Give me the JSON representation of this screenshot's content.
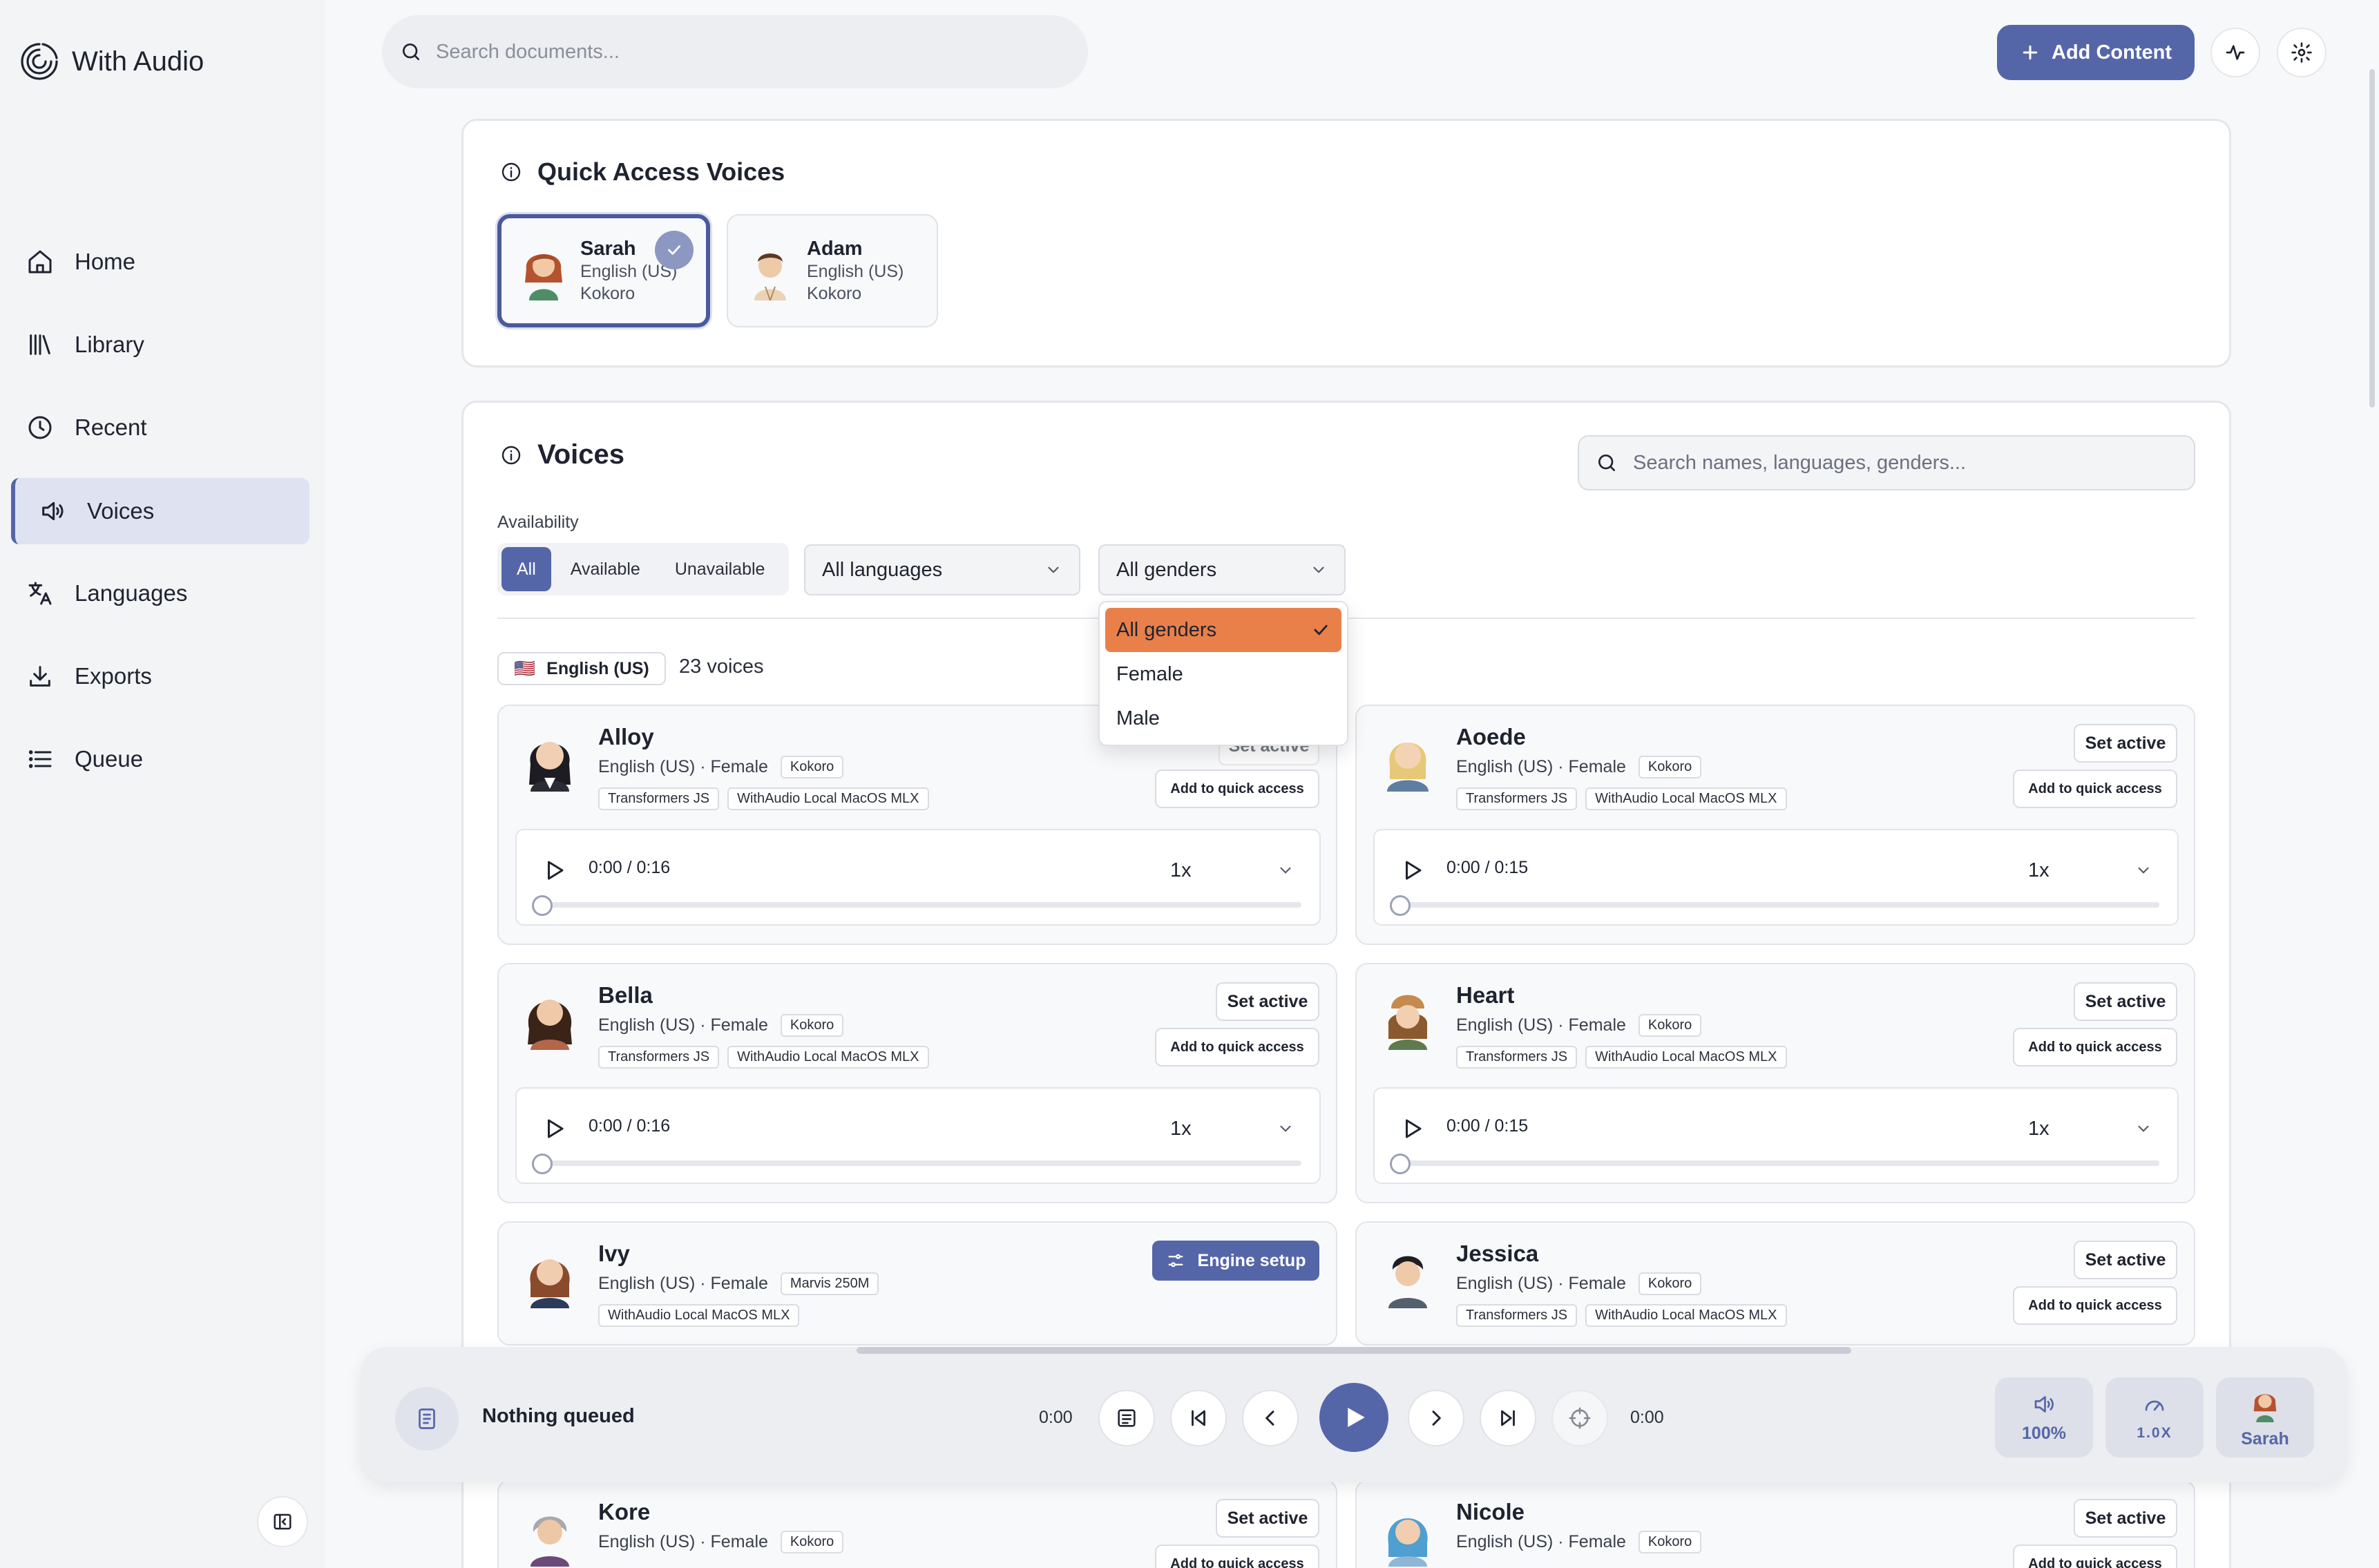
{
  "app": {
    "name": "With Audio"
  },
  "sidebar": {
    "items": [
      {
        "label": "Home",
        "icon": "home-icon"
      },
      {
        "label": "Library",
        "icon": "library-icon"
      },
      {
        "label": "Recent",
        "icon": "clock-icon"
      },
      {
        "label": "Voices",
        "icon": "speaker-icon",
        "active": true
      },
      {
        "label": "Languages",
        "icon": "translate-icon"
      },
      {
        "label": "Exports",
        "icon": "download-icon"
      },
      {
        "label": "Queue",
        "icon": "list-icon"
      }
    ]
  },
  "header": {
    "search_placeholder": "Search documents...",
    "add_content_label": "Add Content"
  },
  "quick_access": {
    "title": "Quick Access Voices",
    "voices": [
      {
        "name": "Sarah",
        "language": "English (US)",
        "engine": "Kokoro",
        "selected": true
      },
      {
        "name": "Adam",
        "language": "English (US)",
        "engine": "Kokoro",
        "selected": false
      }
    ]
  },
  "voices": {
    "title": "Voices",
    "search_placeholder": "Search names, languages, genders...",
    "availability_label": "Availability",
    "availability_options": [
      "All",
      "Available",
      "Unavailable"
    ],
    "availability_selected": "All",
    "language_select": "All languages",
    "gender_select": "All genders",
    "gender_options": [
      "All genders",
      "Female",
      "Male"
    ],
    "group": {
      "flag": "🇺🇸",
      "language": "English (US)",
      "count_text": "23 voices"
    },
    "set_active_label": "Set active",
    "quick_add_label": "Add to quick access",
    "engine_setup_label": "Engine setup",
    "cards": [
      {
        "name": "Alloy",
        "meta": "English (US) · Female",
        "engine": "Kokoro",
        "tags": [
          "Transformers JS",
          "WithAudio Local MacOS MLX"
        ],
        "time": "0:00 / 0:16",
        "rate": "1x"
      },
      {
        "name": "Aoede",
        "meta": "English (US) · Female",
        "engine": "Kokoro",
        "tags": [
          "Transformers JS",
          "WithAudio Local MacOS MLX"
        ],
        "time": "0:00 / 0:15",
        "rate": "1x"
      },
      {
        "name": "Bella",
        "meta": "English (US) · Female",
        "engine": "Kokoro",
        "tags": [
          "Transformers JS",
          "WithAudio Local MacOS MLX"
        ],
        "time": "0:00 / 0:16",
        "rate": "1x"
      },
      {
        "name": "Heart",
        "meta": "English (US) · Female",
        "engine": "Kokoro",
        "tags": [
          "Transformers JS",
          "WithAudio Local MacOS MLX"
        ],
        "time": "0:00 / 0:15",
        "rate": "1x"
      },
      {
        "name": "Ivy",
        "meta": "English (US) · Female",
        "engine": "Marvis 250M",
        "tags": [
          "WithAudio Local MacOS MLX"
        ]
      },
      {
        "name": "Jessica",
        "meta": "English (US) · Female",
        "engine": "Kokoro",
        "tags": [
          "Transformers JS",
          "WithAudio Local MacOS MLX"
        ]
      },
      {
        "name": "Kore",
        "meta": "English (US) · Female",
        "engine": "Kokoro"
      },
      {
        "name": "Nicole",
        "meta": "English (US) · Female",
        "engine": "Kokoro"
      }
    ]
  },
  "playbar": {
    "title": "Nothing queued",
    "time_start": "0:00",
    "time_end": "0:00",
    "volume": "100%",
    "speed": "1.0X",
    "voice": "Sarah"
  },
  "colors": {
    "accent": "#5566a8",
    "dropdown_highlight": "#e9804a"
  }
}
